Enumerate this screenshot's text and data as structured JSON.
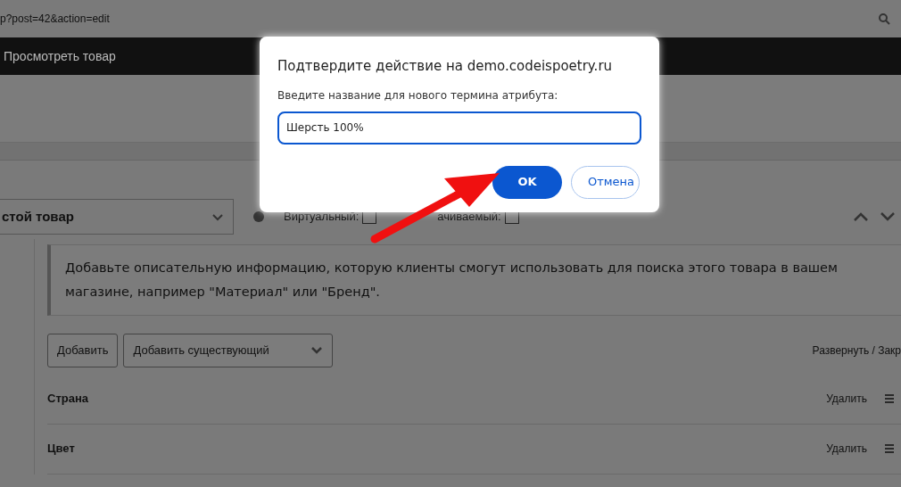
{
  "browser": {
    "url": "p?post=42&action=edit"
  },
  "admin_bar": {
    "items": [
      "Просмотреть товар"
    ]
  },
  "product_data": {
    "type_select": "стой товар",
    "options": [
      {
        "label": "Виртуальный:",
        "checked": false
      },
      {
        "label": "ачиваемый:",
        "checked": false
      }
    ]
  },
  "attributes": {
    "notice": "Добавьте описательную информацию, которую клиенты смогут использовать для поиска этого товара в вашем магазине, например \"Материал\" или \"Бренд\".",
    "add_button": "Добавить",
    "existing_select": "Добавить существующий",
    "expand_link": "Развернуть / Закр",
    "items": [
      {
        "name": "Страна",
        "action": "Удалить"
      },
      {
        "name": "Цвет",
        "action": "Удалить"
      }
    ]
  },
  "dialog": {
    "title": "Подтвердите действие на demo.codeispoetry.ru",
    "message": "Введите название для нового термина атрибута:",
    "value": "Шерсть 100%",
    "buttons": [
      {
        "label": "OK",
        "kind": "primary"
      },
      {
        "label": "Отмена",
        "kind": "secondary"
      }
    ]
  }
}
